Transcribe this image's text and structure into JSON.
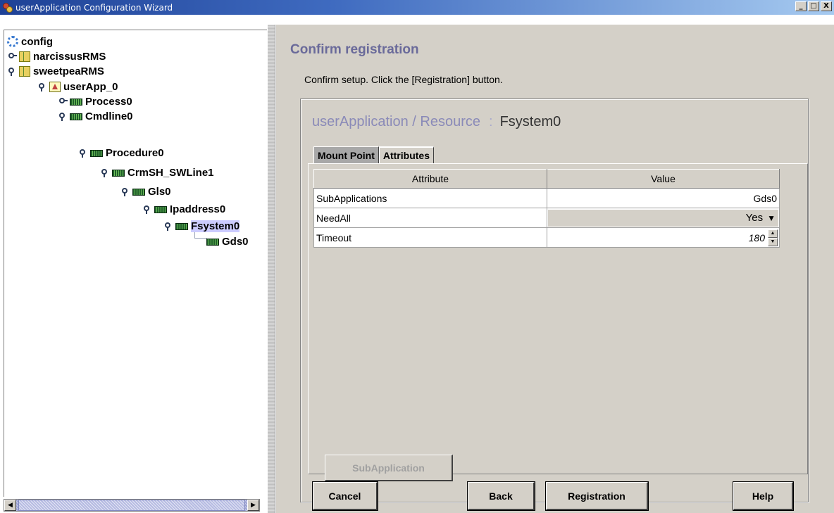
{
  "window": {
    "title": "userApplication Configuration Wizard",
    "buttons": {
      "minimize": "_",
      "maximize": "□",
      "close": "X"
    }
  },
  "tree": {
    "items": [
      {
        "label": "config",
        "icon": "config-icon",
        "level": 0,
        "handle": "none"
      },
      {
        "label": "narcissusRMS",
        "icon": "node-icon",
        "level": 0,
        "handle": "collapsed"
      },
      {
        "label": "sweetpeaRMS",
        "icon": "node-icon",
        "level": 0,
        "handle": "expanded"
      },
      {
        "label": "userApp_0",
        "icon": "app-icon",
        "level": 1,
        "handle": "expanded"
      },
      {
        "label": "Process0",
        "icon": "resource-icon",
        "level": 2,
        "handle": "collapsed"
      },
      {
        "label": "Cmdline0",
        "icon": "resource-icon",
        "level": 2,
        "handle": "expanded"
      },
      {
        "label": "Procedure0",
        "icon": "resource-icon",
        "level": 3,
        "handle": "expanded"
      },
      {
        "label": "CrmSH_SWLine1",
        "icon": "resource-icon",
        "level": 4,
        "handle": "expanded"
      },
      {
        "label": "Gls0",
        "icon": "resource-icon",
        "level": 5,
        "handle": "expanded"
      },
      {
        "label": "Ipaddress0",
        "icon": "resource-icon",
        "level": 6,
        "handle": "expanded"
      },
      {
        "label": "Fsystem0",
        "icon": "resource-icon",
        "level": 7,
        "handle": "expanded",
        "selected": true
      },
      {
        "label": "Gds0",
        "icon": "resource-icon",
        "level": 8,
        "handle": "leaf"
      }
    ]
  },
  "main": {
    "heading": "Confirm registration",
    "instruction": "Confirm setup.  Click the [Registration] button.",
    "resource_path": "userApplication / Resource",
    "resource_separator": ":",
    "resource_name": "Fsystem0",
    "tabs": [
      {
        "label": "Mount Point",
        "active": true
      },
      {
        "label": "Attributes",
        "active": false
      }
    ],
    "table": {
      "headers": [
        "Attribute",
        "Value"
      ],
      "rows": [
        {
          "attribute": "SubApplications",
          "value": "Gds0"
        },
        {
          "attribute": "NeedAll",
          "value": "Yes"
        },
        {
          "attribute": "Timeout",
          "value": "180"
        }
      ]
    },
    "subapplication_button": "SubApplication"
  },
  "footer": {
    "cancel": "Cancel",
    "back": "Back",
    "registration": "Registration",
    "help": "Help"
  }
}
